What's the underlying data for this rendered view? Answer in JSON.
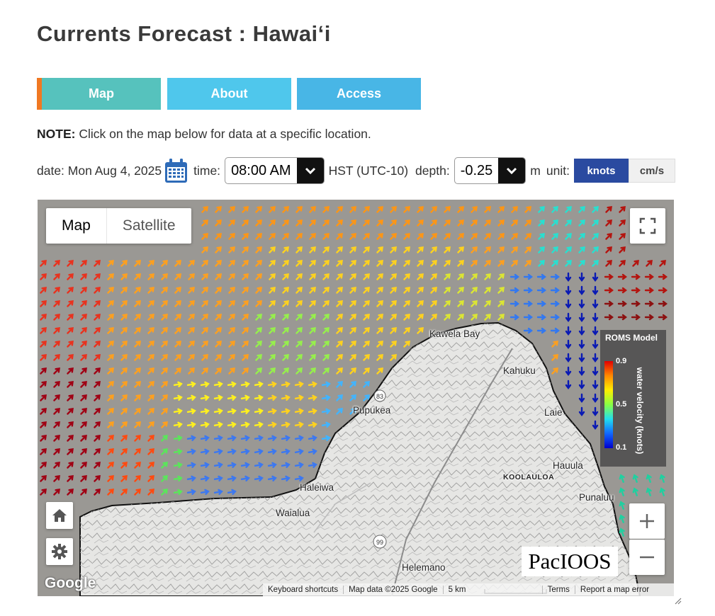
{
  "page": {
    "title": "Currents Forecast : Hawaiʻi"
  },
  "tabs": [
    {
      "label": "Map"
    },
    {
      "label": "About"
    },
    {
      "label": "Access"
    }
  ],
  "note": {
    "prefix": "NOTE:",
    "text": "Click on the map below for data at a specific location."
  },
  "controls": {
    "date_label": "date: Mon Aug 4, 2025",
    "time_label": "time:",
    "time_value": "08:00 AM",
    "timezone": "HST (UTC-10)",
    "depth_label": "depth:",
    "depth_value": "-0.25",
    "depth_unit": "m",
    "unit_label": "unit:",
    "unit_selected": "knots",
    "unit_other": "cm/s"
  },
  "map": {
    "type_map": "Map",
    "type_satellite": "Satellite",
    "legend": {
      "title": "ROMS Model",
      "axis_label": "water velocity (knots)",
      "ticks": [
        "0.9",
        "0.5",
        "0.1"
      ]
    },
    "places": [
      {
        "name": "Kawela Bay"
      },
      {
        "name": "Kahuku"
      },
      {
        "name": "Pupukea"
      },
      {
        "name": "Laie"
      },
      {
        "name": "Hauula"
      },
      {
        "name": "KOOLAULOA"
      },
      {
        "name": "Punaluu"
      },
      {
        "name": "Haleiwa"
      },
      {
        "name": "Waialua"
      },
      {
        "name": "Helemano"
      }
    ],
    "route_labels": [
      "83",
      "99"
    ],
    "brand": "Google",
    "logo": "PacIOOS",
    "attribution": {
      "shortcuts": "Keyboard shortcuts",
      "data": "Map data ©2025 Google",
      "scale": "5 km",
      "terms": "Terms",
      "report": "Report a map error"
    }
  },
  "colors": {
    "tab_map": "#56c2bd",
    "tab_about": "#4fc7ec",
    "tab_access": "#48b6e6",
    "tab_accent": "#f07822",
    "unit_active": "#2a4aa0",
    "ocean": "#9a9894"
  }
}
